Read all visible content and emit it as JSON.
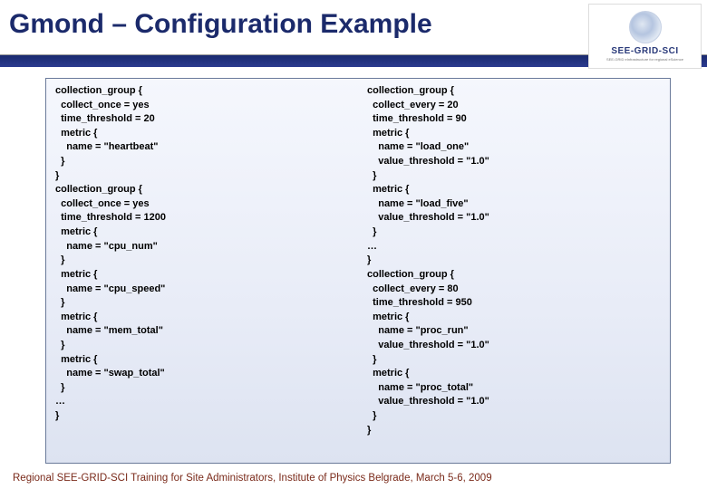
{
  "header": {
    "title": "Gmond – Configuration Example",
    "logo_text": "SEE-GRID-SCI",
    "logo_sub": "SEE-GRID eInfrastructure for regional eScience"
  },
  "left_code": "collection_group {\n  collect_once = yes\n  time_threshold = 20\n  metric {\n    name = \"heartbeat\"\n  }\n}\ncollection_group {\n  collect_once = yes\n  time_threshold = 1200\n  metric {\n    name = \"cpu_num\"\n  }\n  metric {\n    name = \"cpu_speed\"\n  }\n  metric {\n    name = \"mem_total\"\n  }\n  metric {\n    name = \"swap_total\"\n  }\n…\n}",
  "right_code": "collection_group {\n  collect_every = 20\n  time_threshold = 90\n  metric {\n    name = \"load_one\"\n    value_threshold = \"1.0\"\n  }\n  metric {\n    name = \"load_five\"\n    value_threshold = \"1.0\"\n  }\n…\n}\ncollection_group {\n  collect_every = 80\n  time_threshold = 950\n  metric {\n    name = \"proc_run\"\n    value_threshold = \"1.0\"\n  }\n  metric {\n    name = \"proc_total\"\n    value_threshold = \"1.0\"\n  }\n}",
  "footer": "Regional SEE-GRID-SCI Training for Site Administrators, Institute of Physics Belgrade, March 5-6, 2009"
}
